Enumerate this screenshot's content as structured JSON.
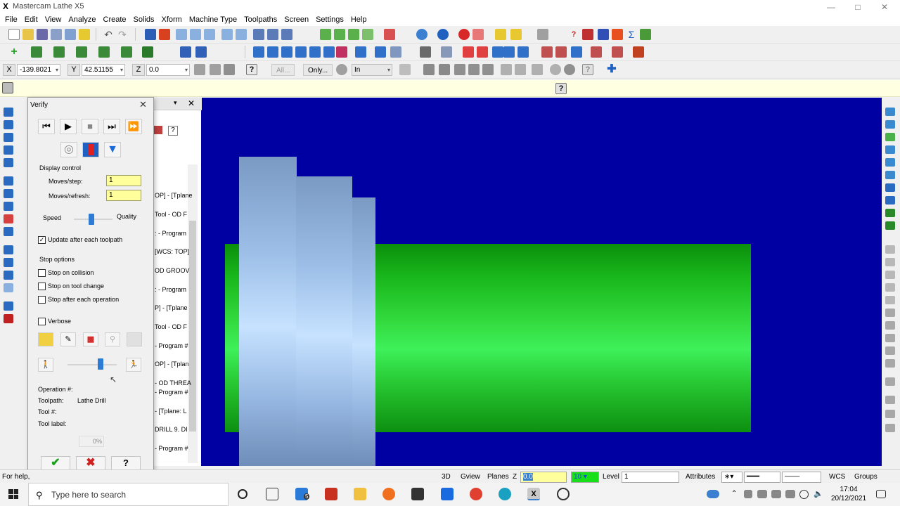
{
  "window": {
    "title": "Mastercam Lathe X5",
    "app_icon": "X"
  },
  "menu": [
    "File",
    "Edit",
    "View",
    "Analyze",
    "Create",
    "Solids",
    "Xform",
    "Machine Type",
    "Toolpaths",
    "Screen",
    "Settings",
    "Help"
  ],
  "coords": {
    "x_label": "X",
    "x_value": "-139.8021",
    "y_label": "Y",
    "y_value": "42.51155",
    "z_label": "Z",
    "z_value": "0.0",
    "all_btn": "All...",
    "only_btn": "Only...",
    "mode_select": "In"
  },
  "ops_manager": {
    "lines": [
      "OP] - [Tplane",
      "Tool - OD F",
      ": - Program",
      "[WCS: TOP]",
      "OD GROOV",
      ": - Program",
      "P] - [Tplane",
      "Tool - OD F",
      "- Program #",
      "OP] - [Tplan",
      "- OD THREA",
      "- Program #",
      "- [Tplane: L",
      "DRILL 9. DI",
      "- Program #"
    ]
  },
  "verify": {
    "title": "Verify",
    "display_control": "Display control",
    "moves_step_label": "Moves/step:",
    "moves_step_value": "1",
    "moves_refresh_label": "Moves/refresh:",
    "moves_refresh_value": "1",
    "speed_label": "Speed",
    "quality_label": "Quality",
    "speed_quality_level": 0.38,
    "update_toolpath_label": "Update after each toolpath",
    "update_toolpath_checked": true,
    "stop_options": "Stop options",
    "stop_collision": "Stop on collision",
    "stop_tool_change": "Stop on tool change",
    "stop_each_op": "Stop after each operation",
    "verbose": "Verbose",
    "sim_speed_level": 0.62,
    "operation_label": "Operation #:",
    "operation_value": "",
    "toolpath_label": "Toolpath:",
    "toolpath_value": "Lathe Drill",
    "tool_label": "Tool #:",
    "tool_value": "",
    "tool_label_label": "Tool label:",
    "tool_label_value": "",
    "progress": "0%"
  },
  "status": {
    "help": "For help,",
    "view_3d": "3D",
    "gview": "Gview",
    "planes": "Planes",
    "z_label": "Z",
    "z_value": "0.0",
    "color_value": "10",
    "level_label": "Level",
    "level_value": "1",
    "attributes": "Attributes",
    "wcs": "WCS",
    "groups": "Groups"
  },
  "taskbar": {
    "search_placeholder": "Type here to search",
    "time": "17:04",
    "date": "20/12/2021",
    "mail_badge": "5"
  },
  "colors": {
    "viewport_bg": "#0000a2",
    "stock_green": "#2ad83a",
    "tool_blue": "#9bbde6",
    "input_yellow": "#ffff9b"
  }
}
